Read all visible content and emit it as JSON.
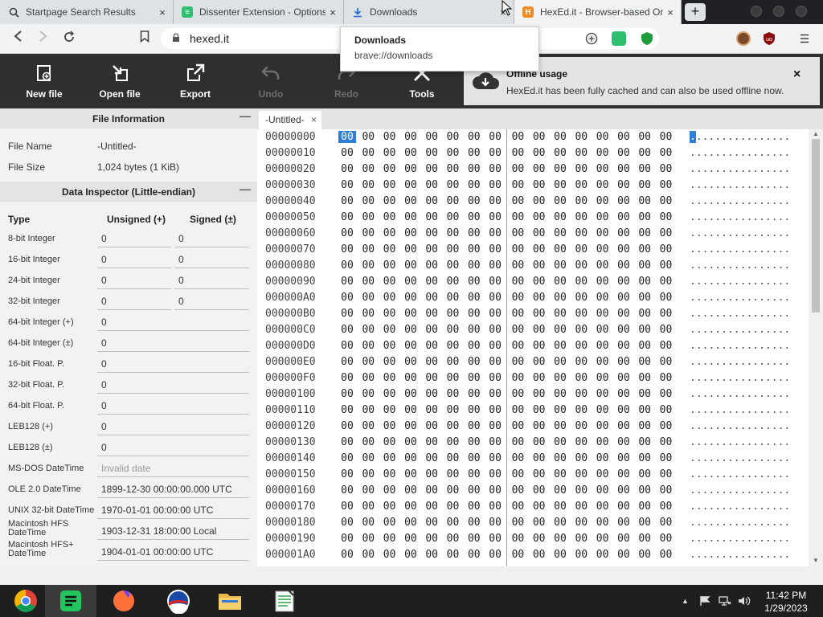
{
  "browser": {
    "tabs": [
      {
        "title": "Startpage Search Results",
        "close": "×"
      },
      {
        "title": "Dissenter Extension - Options",
        "close": "×"
      },
      {
        "title": "Downloads",
        "close": "×"
      },
      {
        "title": "HexEd.it - Browser-based Onl",
        "close": "×"
      }
    ],
    "new_tab": "+",
    "address": "hexed.it",
    "tooltip": {
      "title": "Downloads",
      "url": "brave://downloads"
    }
  },
  "toolbar": {
    "new_file": "New file",
    "open_file": "Open file",
    "export": "Export",
    "undo": "Undo",
    "redo": "Redo",
    "tools": "Tools"
  },
  "notification": {
    "title": "Offline usage",
    "message": "HexEd.it has been fully cached and can also be used offline now.",
    "close": "×"
  },
  "file_info": {
    "heading": "File Information",
    "collapse": "—",
    "name_label": "File Name",
    "name_value": "-Untitled-",
    "size_label": "File Size",
    "size_value": "1,024 bytes (1 KiB)"
  },
  "inspector": {
    "heading": "Data Inspector (Little-endian)",
    "collapse": "—",
    "col_type": "Type",
    "col_unsigned": "Unsigned (+)",
    "col_signed": "Signed (±)",
    "rows": [
      {
        "label": "8-bit Integer",
        "unsigned": "0",
        "signed": "0"
      },
      {
        "label": "16-bit Integer",
        "unsigned": "0",
        "signed": "0"
      },
      {
        "label": "24-bit Integer",
        "unsigned": "0",
        "signed": "0"
      },
      {
        "label": "32-bit Integer",
        "unsigned": "0",
        "signed": "0"
      },
      {
        "label": "64-bit Integer (+)",
        "value": "0"
      },
      {
        "label": "64-bit Integer (±)",
        "value": "0"
      },
      {
        "label": "16-bit Float. P.",
        "value": "0"
      },
      {
        "label": "32-bit Float. P.",
        "value": "0"
      },
      {
        "label": "64-bit Float. P.",
        "value": "0"
      },
      {
        "label": "LEB128 (+)",
        "value": "0"
      },
      {
        "label": "LEB128 (±)",
        "value": "0"
      },
      {
        "label": "MS-DOS DateTime",
        "value": "Invalid date"
      },
      {
        "label": "OLE 2.0 DateTime",
        "value": "1899-12-30 00:00:00.000 UTC"
      },
      {
        "label": "UNIX 32-bit DateTime",
        "value": "1970-01-01 00:00:00 UTC"
      },
      {
        "label": "Macintosh HFS DateTime",
        "value": "1903-12-31 18:00:00 Local"
      },
      {
        "label": "Macintosh HFS+ DateTime",
        "value": "1904-01-01 00:00:00 UTC"
      }
    ]
  },
  "editor": {
    "tab_name": "-Untitled-",
    "tab_close": "×",
    "byte_value": "00",
    "ascii_row": "................",
    "selected_offset": "00000000",
    "addresses": [
      "00000000",
      "00000010",
      "00000020",
      "00000030",
      "00000040",
      "00000050",
      "00000060",
      "00000070",
      "00000080",
      "00000090",
      "000000A0",
      "000000B0",
      "000000C0",
      "000000D0",
      "000000E0",
      "000000F0",
      "00000100",
      "00000110",
      "00000120",
      "00000130",
      "00000140",
      "00000150",
      "00000160",
      "00000170",
      "00000180",
      "00000190",
      "000001A0"
    ]
  },
  "taskbar": {
    "time": "11:42 PM",
    "date": "1/29/2023"
  }
}
